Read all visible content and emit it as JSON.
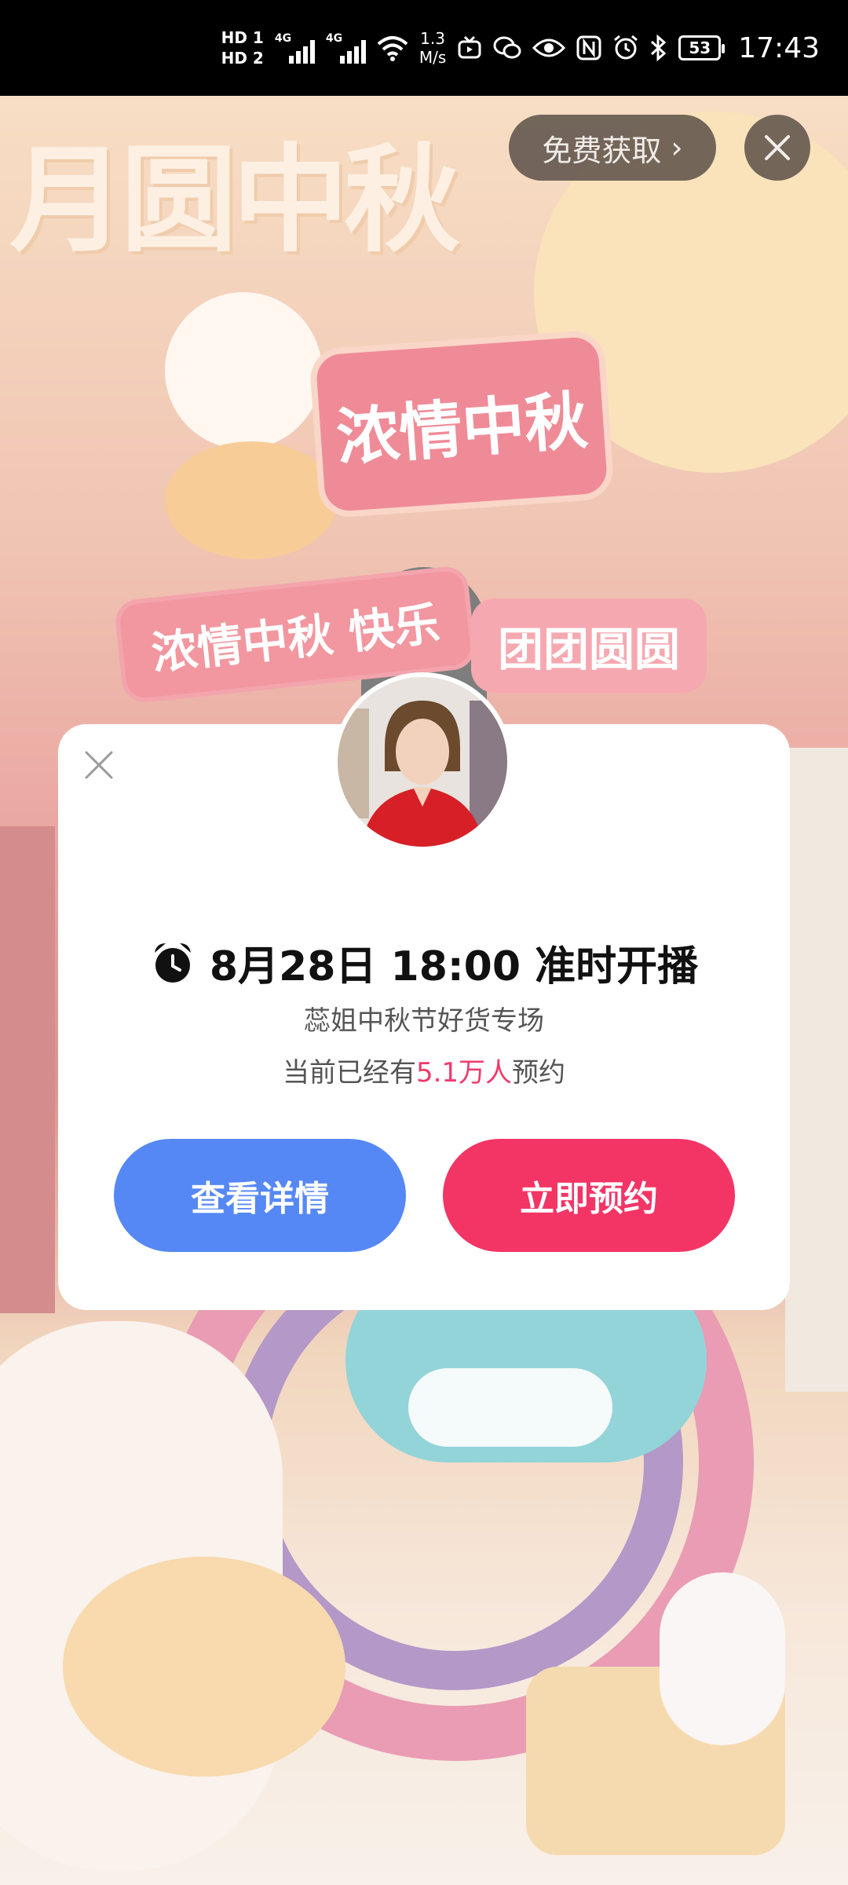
{
  "status_bar": {
    "hd1": "HD 1",
    "hd2": "HD 2",
    "net1": "4G",
    "net2": "4G",
    "speed_value": "1.3",
    "speed_unit": "M/s",
    "battery": "53",
    "time": "17:43"
  },
  "background": {
    "title": "月圆中秋",
    "sign_main": "浓情中秋",
    "sign_sub": "浓情中秋 快乐",
    "sign_side": "团团圆圆"
  },
  "top_actions": {
    "free_label": "免费获取",
    "free_chevron": "›"
  },
  "modal": {
    "schedule": "8月28日 18:00 准时开播",
    "subtitle": "蕊姐中秋节好货专场",
    "stats_prefix": "当前已经有",
    "stats_count": "5.1万人",
    "stats_suffix": "预约",
    "details_button": "查看详情",
    "reserve_button": "立即预约"
  },
  "colors": {
    "accent_blue": "#5688f5",
    "accent_red": "#f33565",
    "highlight_pink": "#ef3a6b"
  },
  "icons": [
    "alarm-clock-icon",
    "close-icon",
    "chevron-right-icon",
    "wifi-icon",
    "bluetooth-icon",
    "nfc-icon",
    "eye-icon",
    "wechat-icon"
  ]
}
